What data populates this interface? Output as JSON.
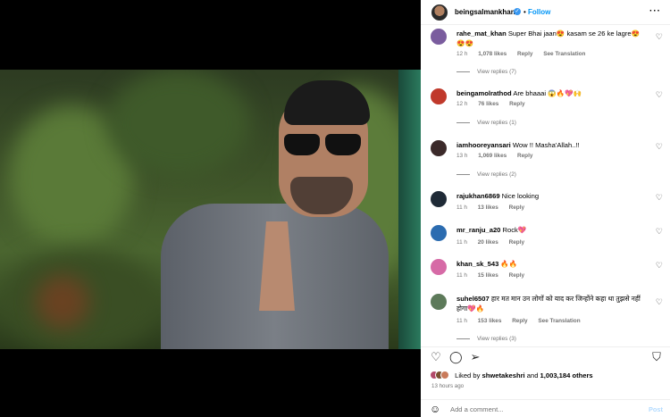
{
  "header": {
    "username": "beingsalmankhan",
    "separator": "•",
    "follow_label": "Follow",
    "more_icon": "more-horizontal-icon"
  },
  "comments": [
    {
      "username": "rahe_mat_khan",
      "text": "Super Bhai jaan😍 kasam se 26 ke lagre😍😍😍",
      "time": "12 h",
      "likes": "1,078 likes",
      "reply": "Reply",
      "extra": "See Translation",
      "view_replies": "View replies (7)",
      "avatar_color": "#7a5c9e"
    },
    {
      "username": "beingamolrathod",
      "text": "Are bhaaai 😱🔥💖🙌",
      "time": "12 h",
      "likes": "76 likes",
      "reply": "Reply",
      "extra": "",
      "view_replies": "View replies (1)",
      "avatar_color": "#c0392b"
    },
    {
      "username": "iamhooreyansari",
      "text": "Wow !! Masha'Allah..!!",
      "time": "13 h",
      "likes": "1,069 likes",
      "reply": "Reply",
      "extra": "",
      "view_replies": "View replies (2)",
      "avatar_color": "#3b2a2a"
    },
    {
      "username": "rajukhan6869",
      "text": "Nice looking",
      "time": "11 h",
      "likes": "13 likes",
      "reply": "Reply",
      "extra": "",
      "view_replies": "",
      "avatar_color": "#1f2a36"
    },
    {
      "username": "mr_ranju_a20",
      "text": "Rock💖",
      "time": "11 h",
      "likes": "20 likes",
      "reply": "Reply",
      "extra": "",
      "view_replies": "",
      "avatar_color": "#2b6cb0"
    },
    {
      "username": "khan_sk_543",
      "text": "🔥🔥",
      "time": "11 h",
      "likes": "15 likes",
      "reply": "Reply",
      "extra": "",
      "view_replies": "",
      "avatar_color": "#d66aa6"
    },
    {
      "username": "suhel6507",
      "text": "हार मत मान उन लोगों को याद कर जिन्होंने कहा था तुझसे नहीं होगा💖🔥",
      "time": "11 h",
      "likes": "153 likes",
      "reply": "Reply",
      "extra": "See Translation",
      "view_replies": "View replies (3)",
      "avatar_color": "#5d7a5a"
    }
  ],
  "actions": {
    "like_icon": "heart-icon",
    "comment_icon": "comment-icon",
    "share_icon": "share-icon",
    "save_icon": "bookmark-icon",
    "liked_by_prefix": "Liked by ",
    "liked_by_user": "shwetakeshri",
    "liked_by_suffix": " and ",
    "liked_by_count": "1,003,184 others",
    "time_ago": "13 hours ago"
  },
  "comment_box": {
    "emoji_icon": "emoji-icon",
    "placeholder": "Add a comment...",
    "post_label": "Post"
  }
}
